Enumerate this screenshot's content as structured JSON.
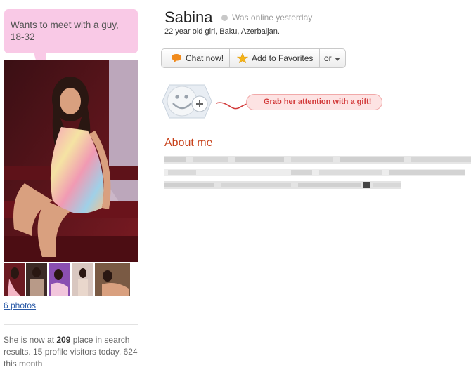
{
  "preference": {
    "text": "Wants to meet with a guy, 18-32"
  },
  "profile": {
    "name": "Sabina",
    "status": "Was online yesterday",
    "details": "22 year old girl, Baku, Azerbaijan."
  },
  "actions": {
    "chat_label": "Chat now!",
    "favorite_label": "Add to Favorites",
    "more_label": "or"
  },
  "gift": {
    "label": "Grab her attention with a gift!"
  },
  "about": {
    "heading": "About me"
  },
  "photos": {
    "link_label": "6 photos",
    "thumbnail_count": 5
  },
  "stats": {
    "prefix": "She is now at ",
    "place": "209",
    "suffix": " place in search results. 15 profile visitors today, 624 this month"
  },
  "colors": {
    "bubble": "#f9c9e6",
    "about_heading": "#c8431c",
    "gift_text": "#d23a3a",
    "link": "#2a5aa7"
  }
}
